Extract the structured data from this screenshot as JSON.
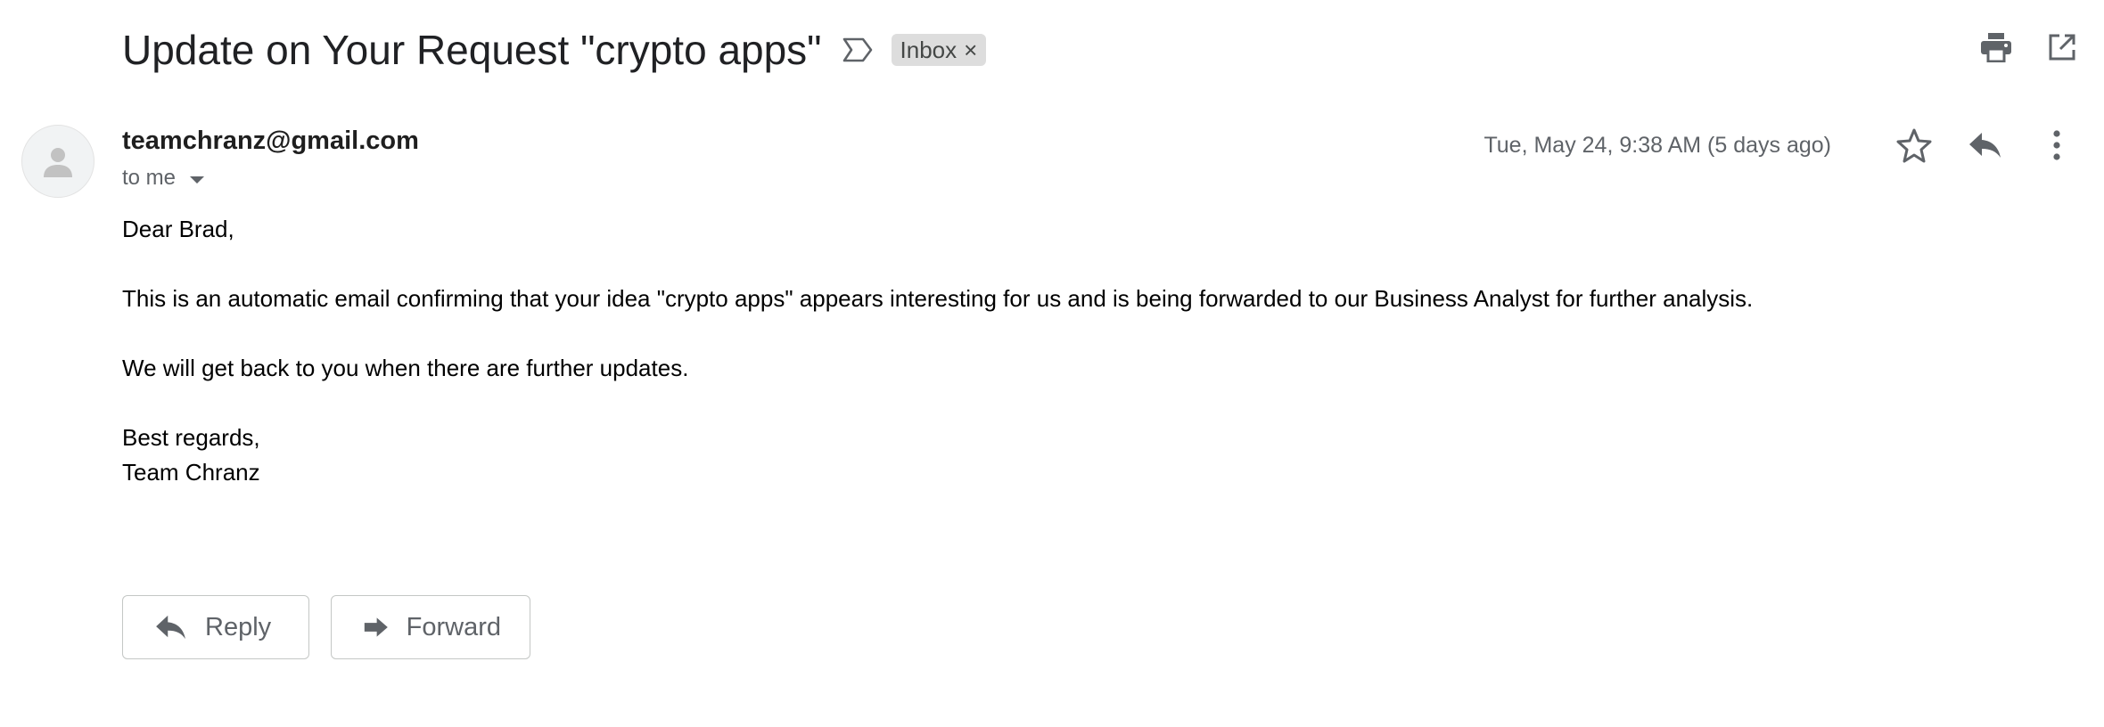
{
  "header": {
    "subject": "Update on Your Request \"crypto apps\"",
    "label_chip": "Inbox",
    "label_chip_close": "×"
  },
  "message": {
    "sender_email": "teamchranz@gmail.com",
    "recipient": "to me",
    "timestamp": "Tue, May 24, 9:38 AM (5 days ago)",
    "body": {
      "greeting": "Dear Brad,",
      "paragraph1": "This is an automatic email confirming that your idea \"crypto apps\" appears interesting for us and is being forwarded to our Business Analyst for further analysis.",
      "paragraph2": "We will get back to you when there are further updates.",
      "closing": "Best regards,",
      "signature": "Team Chranz"
    }
  },
  "actions": {
    "reply_label": "Reply",
    "forward_label": "Forward"
  },
  "icons": {
    "importance": "label-important-outline-icon",
    "print": "print-icon",
    "open_new_window": "open-in-new-icon",
    "star": "star-outline-icon",
    "reply": "reply-icon",
    "more": "more-vert-icon",
    "avatar": "default-avatar-icon",
    "forward": "forward-icon"
  },
  "colors": {
    "chip_bg": "#dddddd",
    "icon_gray": "#5f6368",
    "text_dark": "#202124"
  }
}
